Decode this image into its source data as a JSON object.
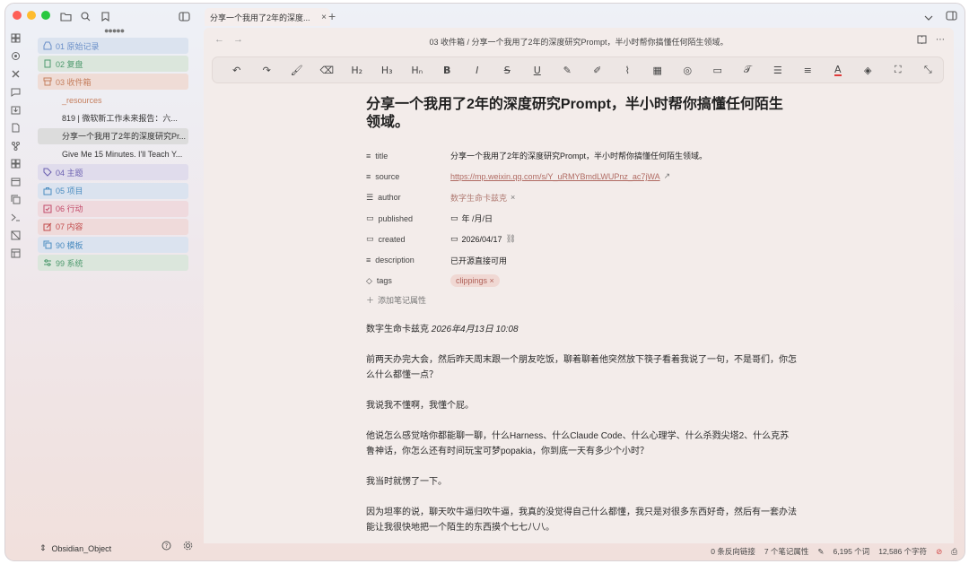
{
  "sidebar": {
    "tree": [
      {
        "label": "01 原始记录",
        "color": "#6a8fc8",
        "bg": "#dbe3ef",
        "icon": "inbox-icon"
      },
      {
        "label": "02 复盘",
        "color": "#4e9a6e",
        "bg": "#dbe6dc",
        "icon": "clipboard-icon"
      },
      {
        "label": "03 收件箱",
        "color": "#c57f5e",
        "bg": "#efdcd6",
        "icon": "archive-icon"
      },
      {
        "label": "04 主题",
        "color": "#6a5fb0",
        "bg": "#e0dcec",
        "icon": "tag-icon"
      },
      {
        "label": "05 项目",
        "color": "#4b8cc0",
        "bg": "#dbe3ef",
        "icon": "briefcase-icon"
      },
      {
        "label": "06 行动",
        "color": "#c24b6a",
        "bg": "#efdade",
        "icon": "checkbox-icon"
      },
      {
        "label": "07 内容",
        "color": "#c24b4b",
        "bg": "#efdada",
        "icon": "edit-icon"
      },
      {
        "label": "90 模板",
        "color": "#4b8cc0",
        "bg": "#dbe3ef",
        "icon": "copy-icon"
      },
      {
        "label": "99 系统",
        "color": "#4e9a6e",
        "bg": "#dbe6dc",
        "icon": "settings-sliders-icon"
      }
    ],
    "inbox_children": [
      "_resources",
      "819 | 微软新工作未来报告：六...",
      "分享一个我用了2年的深度研究Pr...",
      "Give Me 15 Minutes. I'll Teach Y..."
    ],
    "vault_name": "Obsidian_Object"
  },
  "tab": {
    "title": "分享一个我用了2年的深度..."
  },
  "breadcrumb": "03 收件箱 / 分享一个我用了2年的深度研究Prompt，半小时帮你搞懂任何陌生领域。",
  "toolbar": {
    "h2": "H₂",
    "h3": "H₃",
    "hn": "Hₙ",
    "bold": "B",
    "italic": "I",
    "strike": "S",
    "underline": "U"
  },
  "doc": {
    "title": "分享一个我用了2年的深度研究Prompt，半小时帮你搞懂任何陌生领域。",
    "properties": {
      "title_key": "title",
      "title_val": "分享一个我用了2年的深度研究Prompt，半小时帮你搞懂任何陌生领域。",
      "source_key": "source",
      "source_val": "https://mp.weixin.qq.com/s/Y_uRMYBmdLWUPnz_ac7jWA",
      "author_key": "author",
      "author_val": "数字生命卡兹克",
      "published_key": "published",
      "published_val": "年 /月/日",
      "created_key": "created",
      "created_val": "2026/04/17",
      "description_key": "description",
      "description_val": "已开源直接可用",
      "tags_key": "tags",
      "tags_val": "clippings",
      "add_label": "添加笔记属性"
    },
    "byline_author": "数字生命卡兹克",
    "byline_date": "2026年4月13日 10:08",
    "paragraphs": [
      "前两天办完大会，然后昨天周末跟一个朋友吃饭，聊着聊着他突然放下筷子看着我说了一句，不是哥们，你怎么什么都懂一点？",
      "我说我不懂啊，我懂个屁。",
      "他说怎么感觉啥你都能聊一聊，什么Harness、什么Claude Code、什么心理学、什么杀戮尖塔2、什么克苏鲁神话，你怎么还有时间玩宝可梦popakia，你到底一天有多少个小时？",
      "我当时就愣了一下。",
      "因为坦率的说，聊天吹牛逼归吹牛逼，我真的没觉得自己什么都懂，我只是对很多东西好奇，然后有一套办法能让我很快地把一个陌生的东西摸个七七八八。"
    ]
  },
  "status": {
    "backlinks": "0 条反向链接",
    "props": "7 个笔记属性",
    "words": "6,195 个词",
    "chars": "12,586 个字符"
  }
}
